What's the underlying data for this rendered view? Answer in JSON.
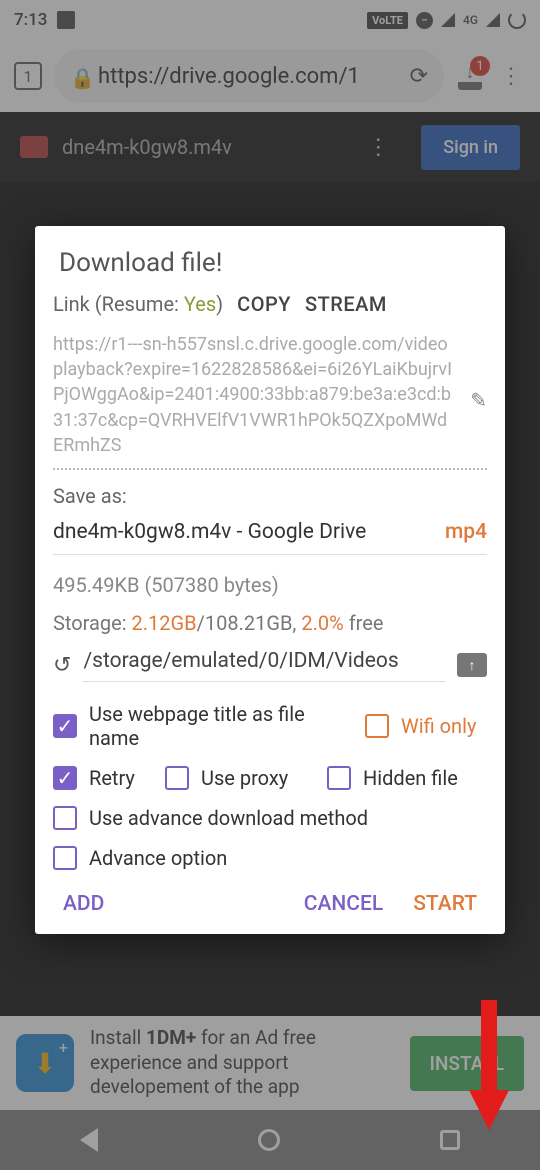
{
  "status": {
    "time": "7:13",
    "volte": "VoLTE",
    "net": "4G"
  },
  "browser": {
    "tab_count": "1",
    "url": "https://drive.google.com/1",
    "download_badge": "1"
  },
  "page": {
    "file_name": "dne4m-k0gw8.m4v",
    "signin": "Sign in"
  },
  "modal": {
    "title": "Download file!",
    "link_prefix": "Link (Resume: ",
    "resume_val": "Yes",
    "link_suffix": ")",
    "copy": "COPY",
    "stream": "STREAM",
    "url_text": "https://r1---sn-h557snsl.c.drive.google.com/videoplayback?expire=1622828586&ei=6i26YLaiKbujrvIPjOWggAo&ip=2401:4900:33bb:a879:be3a:e3cd:b31:37c&cp=QVRHVElfV1VWR1hPOk5QZXpoMWdERmhZS",
    "save_as_label": "Save as:",
    "save_as_name": "dne4m-k0gw8.m4v - Google Drive",
    "save_as_ext": "mp4",
    "size_line": "495.49KB (507380 bytes)",
    "storage_prefix": "Storage: ",
    "storage_used": "2.12GB",
    "storage_mid": "/108.21GB, ",
    "storage_free_pct": "2.0%",
    "storage_suffix": " free",
    "path": "/storage/emulated/0/IDM/Videos",
    "opts": {
      "webpage_title": "Use webpage title as file name",
      "wifi_only": "Wifi only",
      "retry": "Retry",
      "use_proxy": "Use proxy",
      "hidden_file": "Hidden file",
      "advance_method": "Use advance download method",
      "advance_option": "Advance option"
    },
    "actions": {
      "add": "ADD",
      "cancel": "CANCEL",
      "start": "START"
    }
  },
  "ad": {
    "prefix": "Install ",
    "name": "1DM+",
    "rest": " for an Ad free experience and support developement of the app",
    "install": "INSTALL"
  }
}
